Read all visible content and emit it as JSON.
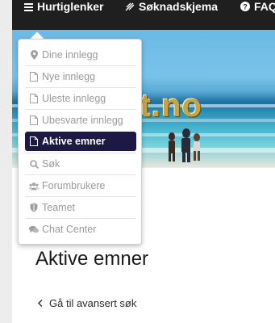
{
  "navbar": {
    "items": [
      {
        "label": "Hurtiglenker",
        "icon": "bars-icon"
      },
      {
        "label": "Søknadskjema",
        "icon": "feather-icon"
      },
      {
        "label": "FAQ",
        "icon": "question-circle-icon"
      }
    ]
  },
  "banner": {
    "logo_text": "net.no"
  },
  "menu": {
    "items": [
      {
        "label": "Dine innlegg",
        "icon": "map-marker-icon",
        "active": false
      },
      {
        "label": "Nye innlegg",
        "icon": "file-icon",
        "active": false
      },
      {
        "label": "Uleste innlegg",
        "icon": "file-icon",
        "active": false
      },
      {
        "label": "Ubesvarte innlegg",
        "icon": "file-icon",
        "active": false
      },
      {
        "label": "Aktive emner",
        "icon": "file-icon",
        "active": true
      },
      {
        "label": "Søk",
        "icon": "search-icon",
        "active": false
      },
      {
        "label": "Forumbrukere",
        "icon": "users-icon",
        "active": false
      },
      {
        "label": "Teamet",
        "icon": "shield-icon",
        "active": false
      },
      {
        "label": "Chat Center",
        "icon": "comments-icon",
        "active": false
      }
    ]
  },
  "page": {
    "title": "Aktive emner",
    "back_link": "Gå til avansert søk"
  },
  "colors": {
    "navbar_bg": "#1f1f1f",
    "active_item_bg": "#1d1844",
    "menu_text": "#9a9a9a"
  }
}
